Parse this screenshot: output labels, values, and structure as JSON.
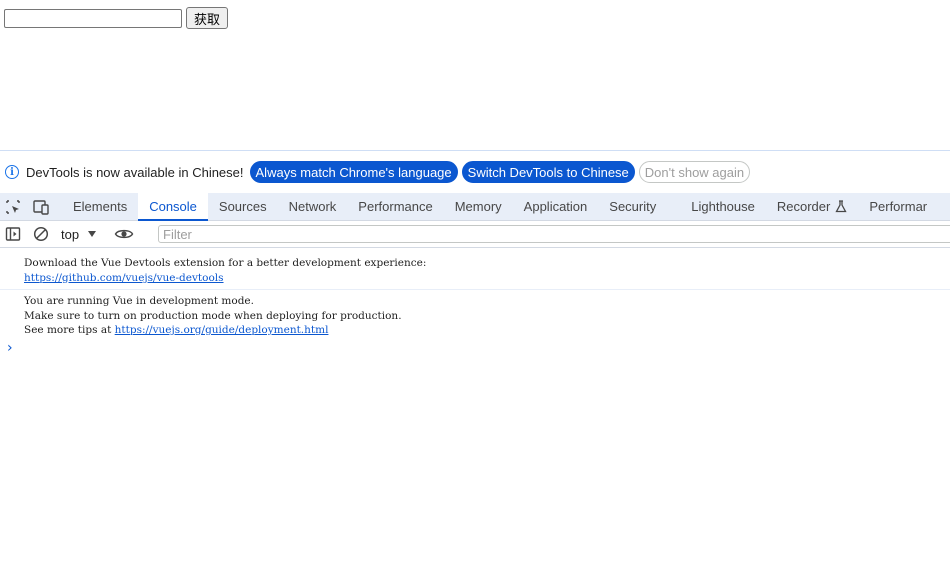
{
  "page": {
    "input_value": "",
    "button_label": "获取"
  },
  "infobar": {
    "message": "DevTools is now available in Chinese!",
    "btn_match": "Always match Chrome's language",
    "btn_switch": "Switch DevTools to Chinese",
    "btn_dismiss": "Don't show again"
  },
  "tabs": [
    "Elements",
    "Console",
    "Sources",
    "Network",
    "Performance",
    "Memory",
    "Application",
    "Security",
    "Lighthouse",
    "Recorder",
    "Performar"
  ],
  "active_tab": "Console",
  "toolbar": {
    "context": "top",
    "filter_placeholder": "Filter"
  },
  "console": {
    "msg1_line1": "Download the Vue Devtools extension for a better development experience:",
    "msg1_link": "https://github.com/vuejs/vue-devtools",
    "msg2_line1": "You are running Vue in development mode.",
    "msg2_line2": "Make sure to turn on production mode when deploying for production.",
    "msg2_line3_prefix": "See more tips at ",
    "msg2_link": "https://vuejs.org/guide/deployment.html",
    "prompt": "›"
  }
}
